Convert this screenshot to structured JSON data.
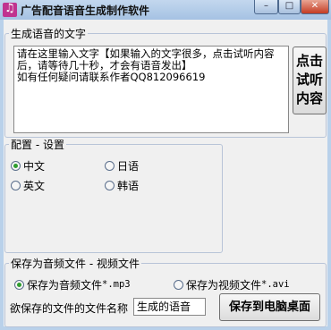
{
  "window": {
    "title": "广告配音语音生成制作软件",
    "minimize_glyph": "–",
    "maximize_glyph": "□",
    "close_glyph": "✕",
    "icon": "music-note-icon"
  },
  "voice_group": {
    "legend": "生成语音的文字",
    "text": "请在这里输入文字【如果输入的文字很多，点击试听内容后，请等待几十秒，才会有语音发出】\n如有任何疑问请联系作者QQ812096619",
    "listen_label_1": "点击",
    "listen_label_2": "试听",
    "listen_label_3": "内容"
  },
  "config_group": {
    "legend": "配置 - 设置",
    "options": [
      "中文",
      "日语",
      "英文",
      "韩语"
    ],
    "selected": "中文"
  },
  "save_group": {
    "legend": "保存为音频文件 - 视频文件",
    "audio_label": "保存为音频文件",
    "audio_ext": "*.mp3",
    "video_label": "保存为视频文件",
    "video_ext": "*.avi",
    "selected": "audio",
    "filename_label": "欲保存的文件的文件名称",
    "filename_value": "生成的语音",
    "save_button": "保存到电脑桌面"
  }
}
